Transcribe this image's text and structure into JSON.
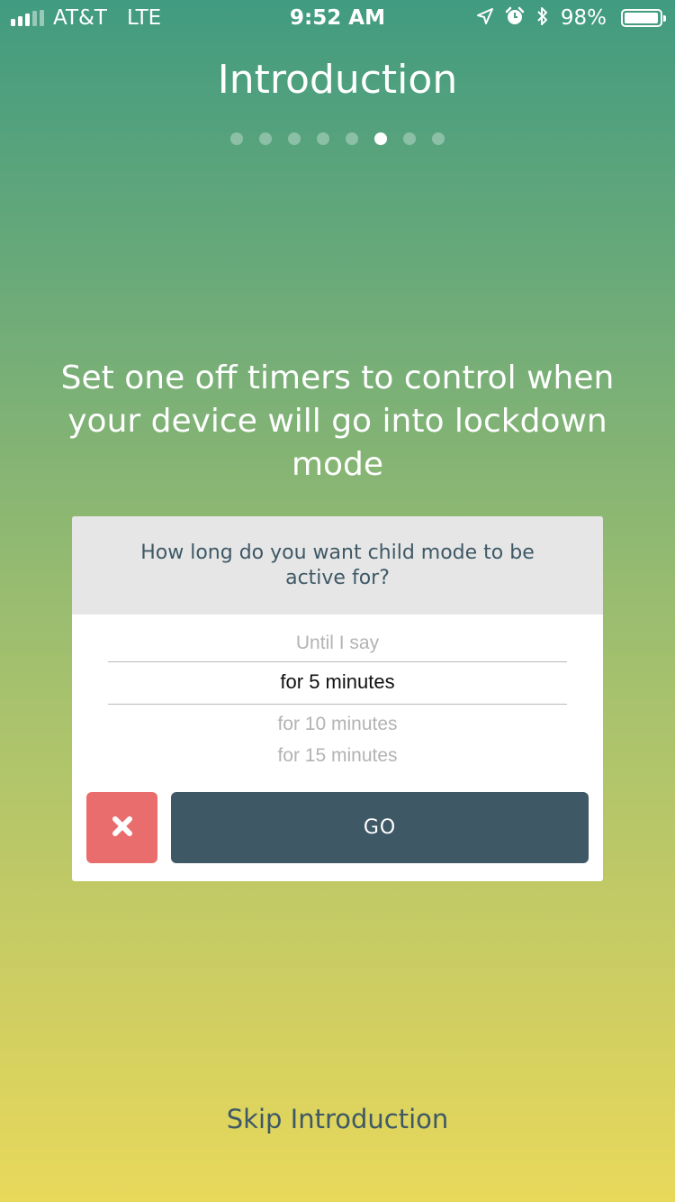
{
  "status_bar": {
    "carrier": "AT&T",
    "network": "LTE",
    "time": "9:52 AM",
    "battery_percent_label": "98%",
    "battery_level": 0.98,
    "signal_bars_filled": 3,
    "signal_bars_total": 5,
    "icons": [
      "location-arrow-icon",
      "alarm-icon",
      "bluetooth-icon",
      "battery-icon"
    ]
  },
  "header": {
    "title": "Introduction",
    "page_count": 8,
    "active_page_index": 5
  },
  "headline": "Set one off timers to control when your device will go into lockdown mode",
  "dialog": {
    "question": "How long do you want child mode to be active for?",
    "options": [
      "Until I say",
      "for 5 minutes",
      "for 10 minutes",
      "for 15 minutes"
    ],
    "selected_option": "for 5 minutes",
    "cancel_icon": "close-x-icon",
    "go_label": "GO",
    "colors": {
      "cancel": "#ea6d6d",
      "go": "#3e5866",
      "header_bg": "#e6e6e6"
    }
  },
  "footer": {
    "skip_label": "Skip Introduction"
  }
}
